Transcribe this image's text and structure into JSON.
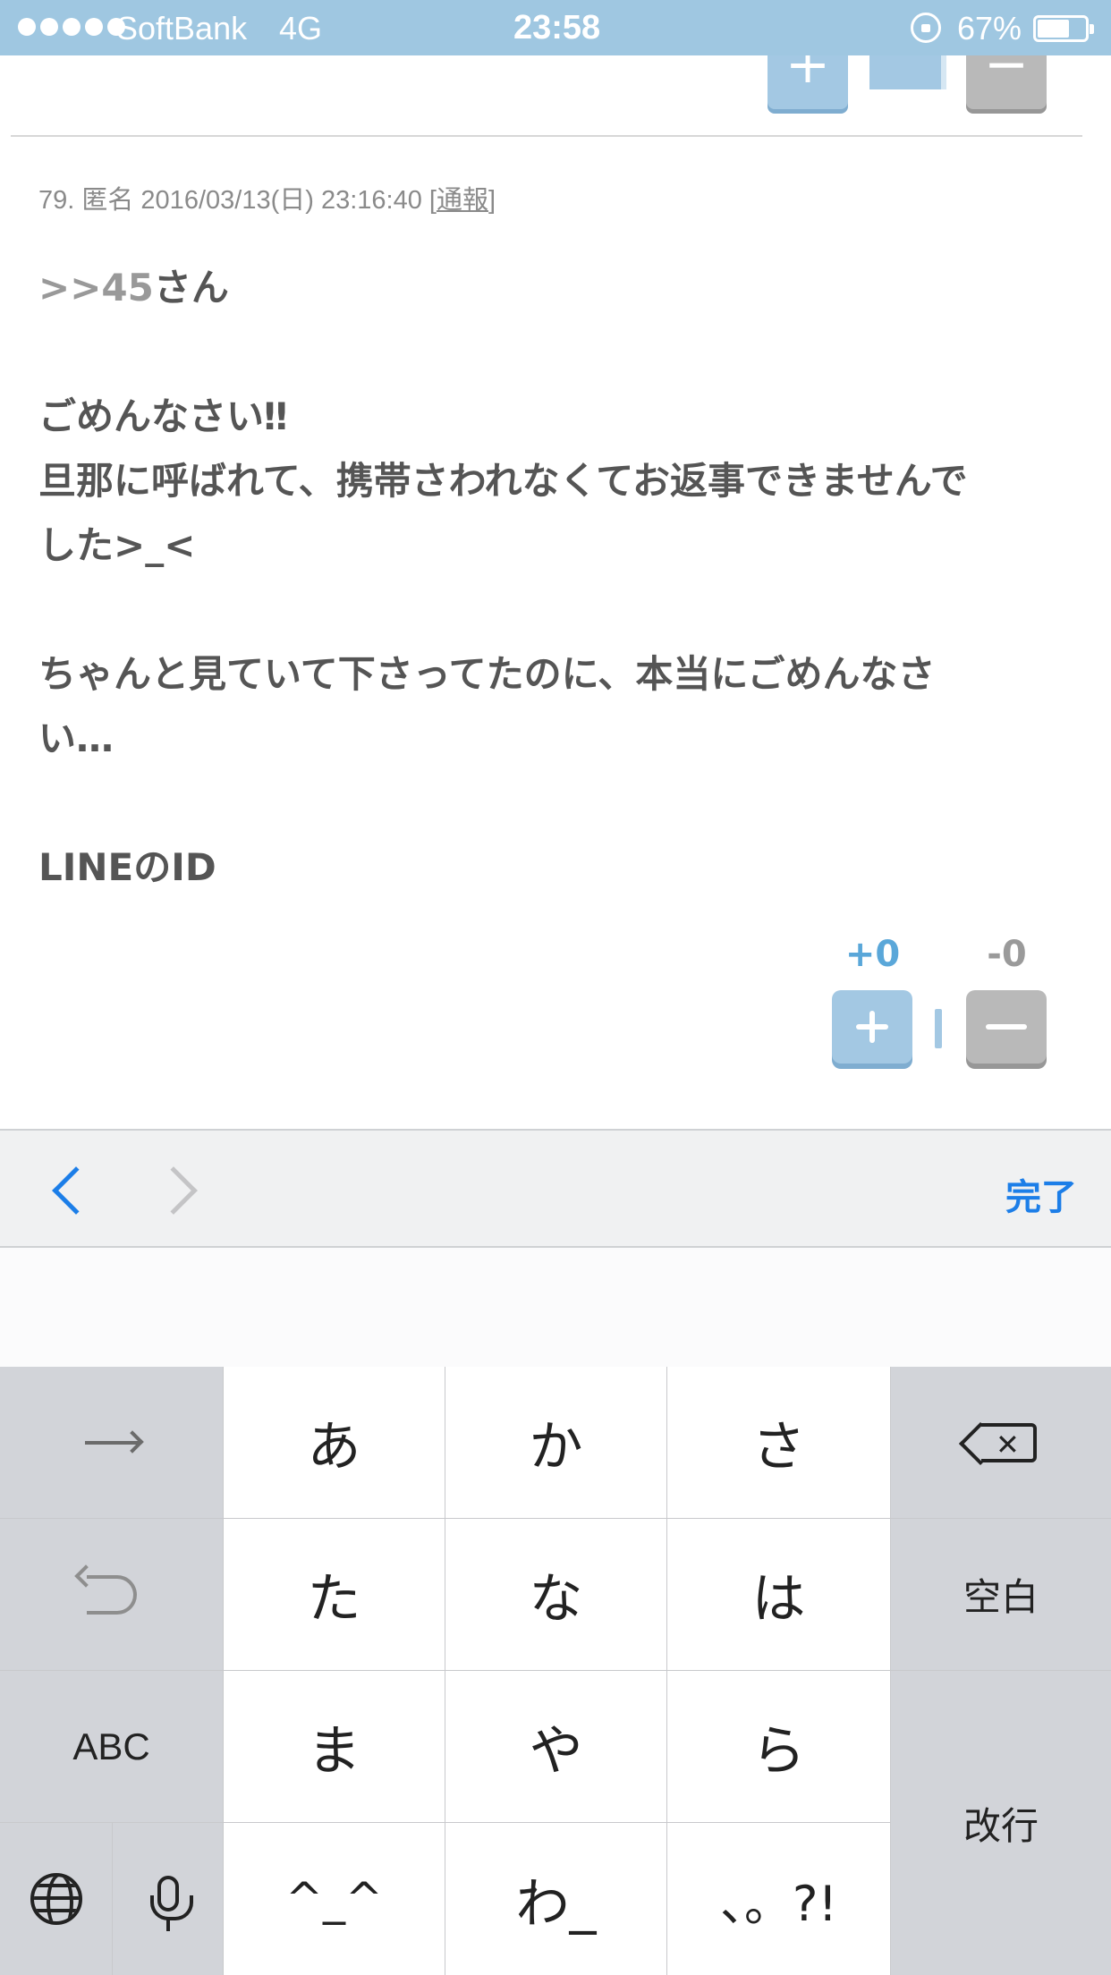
{
  "status_bar": {
    "carrier": "SoftBank",
    "network": "4G",
    "time": "23:58",
    "battery": "67%",
    "battery_level": 0.67
  },
  "post": {
    "meta_prefix": "79. 匿名 2016/03/13(日) 23:16:40 [",
    "report_label": "通報",
    "meta_suffix": "]",
    "anchor": ">>45",
    "lines": [
      "さん",
      "",
      "ごめんなさい‼",
      "旦那に呼ばれて、携帯さわれなくてお返事できませんで",
      "した>_<",
      "",
      "ちゃんと見ていて下さってたのに、本当にごめんなさ",
      "い…",
      "",
      "LINEのID"
    ],
    "plus_count": "+0",
    "minus_count": "-0"
  },
  "accessory_bar": {
    "done_label": "完了"
  },
  "keyboard": {
    "keys": {
      "a": "あ",
      "ka": "か",
      "sa": "さ",
      "ta": "た",
      "na": "な",
      "ha": "は",
      "ma": "ま",
      "ya": "や",
      "ra": "ら",
      "emoticon": "^_^",
      "wa": "わ_",
      "punct": "、。?!",
      "abc": "ABC",
      "space": "空白",
      "return": "改行"
    }
  },
  "colors": {
    "status_bar": "#9fc7e1",
    "accent": "#1c7ee8",
    "plus_button": "#a3c8e3",
    "minus_button": "#b9b9b9",
    "body_text": "#555555"
  }
}
